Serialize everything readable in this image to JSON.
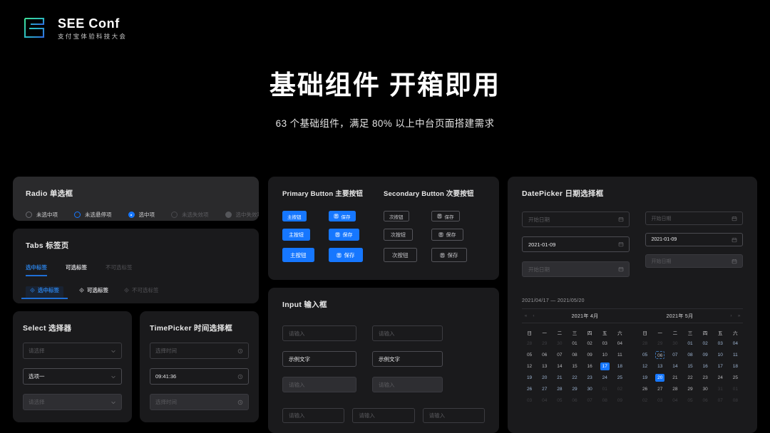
{
  "brand": {
    "title": "SEE Conf",
    "subtitle": "支付宝体验科技大会"
  },
  "hero": {
    "title": "基础组件 开箱即用",
    "subtitle": "63 个基础组件，满足 80% 以上中台页面搭建需求"
  },
  "accent": "#1677ff",
  "radio": {
    "title": "Radio 单选框",
    "options": [
      {
        "label": "未选中项",
        "state": "default"
      },
      {
        "label": "未选悬停项",
        "state": "hover"
      },
      {
        "label": "选中项",
        "state": "checked"
      },
      {
        "label": "未选失效项",
        "state": "disabled"
      },
      {
        "label": "选中失效项",
        "state": "checked-disabled"
      }
    ]
  },
  "tabs": {
    "title": "Tabs 标签页",
    "row1": [
      {
        "label": "选中标签",
        "state": "active"
      },
      {
        "label": "可选标签",
        "state": "default"
      },
      {
        "label": "不可选标签",
        "state": "disabled"
      }
    ],
    "row2": [
      {
        "label": "选中标签",
        "state": "active"
      },
      {
        "label": "可选标签",
        "state": "default"
      },
      {
        "label": "不可选标签",
        "state": "disabled"
      }
    ]
  },
  "select": {
    "title": "Select 选择器",
    "fields": [
      {
        "text": "请选择",
        "type": "placeholder"
      },
      {
        "text": "选项一",
        "type": "value"
      },
      {
        "text": "请选择",
        "type": "disabled"
      }
    ]
  },
  "timepicker": {
    "title": "TimePicker 时间选择框",
    "fields": [
      {
        "text": "选择时间",
        "type": "placeholder"
      },
      {
        "text": "09:41:36",
        "type": "value"
      },
      {
        "text": "选择时间",
        "type": "disabled"
      }
    ]
  },
  "buttons": {
    "primary_title": "Primary Button 主要按钮",
    "secondary_title": "Secondary Button 次要按钮",
    "primary_label": "主按钮",
    "primary_icon_label": "保存",
    "secondary_label": "次按钮",
    "secondary_icon_label": "保存",
    "sizes": [
      "s1",
      "s2",
      "s3"
    ]
  },
  "input": {
    "title": "Input 输入框",
    "left": [
      {
        "text": "请输入",
        "type": "placeholder"
      },
      {
        "text": "示例文字",
        "type": "value"
      },
      {
        "text": "请输入",
        "type": "disabled"
      }
    ],
    "right": [
      {
        "text": "请输入",
        "type": "placeholder"
      },
      {
        "text": "示例文字",
        "type": "value"
      },
      {
        "text": "请输入",
        "type": "disabled"
      }
    ],
    "bottom": [
      {
        "text": "请输入",
        "type": "placeholder"
      },
      {
        "text": "请输入",
        "type": "placeholder"
      },
      {
        "text": "请输入",
        "type": "placeholder"
      }
    ]
  },
  "datepicker": {
    "title": "DatePicker 日期选择框",
    "left": [
      {
        "text": "开始日期",
        "type": "placeholder"
      },
      {
        "text": "2021-01-09",
        "type": "value"
      },
      {
        "text": "开始日期",
        "type": "disabled"
      }
    ],
    "right": [
      {
        "text": "开始日期",
        "type": "placeholder"
      },
      {
        "text": "2021-01-09",
        "type": "value"
      },
      {
        "text": "开始日期",
        "type": "disabled"
      }
    ],
    "range_text": "2021/04/17 — 2021/05/20",
    "weekdays": [
      "日",
      "一",
      "二",
      "三",
      "四",
      "五",
      "六"
    ],
    "month_left": "2021年 4月",
    "month_right": "2021年 5月",
    "nav": {
      "prev_year": "«",
      "prev_month": "‹",
      "next_month": "›",
      "next_year": "»"
    },
    "calendar_left": {
      "weeks": [
        [
          {
            "d": "28",
            "c": "out"
          },
          {
            "d": "29",
            "c": "out"
          },
          {
            "d": "30",
            "c": "out"
          },
          {
            "d": "01",
            "c": ""
          },
          {
            "d": "02",
            "c": ""
          },
          {
            "d": "03",
            "c": ""
          },
          {
            "d": "04",
            "c": ""
          }
        ],
        [
          {
            "d": "05",
            "c": ""
          },
          {
            "d": "06",
            "c": ""
          },
          {
            "d": "07",
            "c": ""
          },
          {
            "d": "08",
            "c": ""
          },
          {
            "d": "09",
            "c": ""
          },
          {
            "d": "10",
            "c": ""
          },
          {
            "d": "11",
            "c": ""
          }
        ],
        [
          {
            "d": "12",
            "c": ""
          },
          {
            "d": "13",
            "c": ""
          },
          {
            "d": "14",
            "c": ""
          },
          {
            "d": "15",
            "c": ""
          },
          {
            "d": "16",
            "c": ""
          },
          {
            "d": "17",
            "c": "sel"
          },
          {
            "d": "18",
            "c": "rng"
          }
        ],
        [
          {
            "d": "19",
            "c": "rng"
          },
          {
            "d": "20",
            "c": "rng"
          },
          {
            "d": "21",
            "c": "rng"
          },
          {
            "d": "22",
            "c": "rng"
          },
          {
            "d": "23",
            "c": "rng"
          },
          {
            "d": "24",
            "c": "rng"
          },
          {
            "d": "25",
            "c": "rng"
          }
        ],
        [
          {
            "d": "26",
            "c": "rng"
          },
          {
            "d": "27",
            "c": "rng"
          },
          {
            "d": "28",
            "c": "rng"
          },
          {
            "d": "29",
            "c": "rng"
          },
          {
            "d": "30",
            "c": "rng"
          },
          {
            "d": "01",
            "c": "out"
          },
          {
            "d": "02",
            "c": "out"
          }
        ],
        [
          {
            "d": "03",
            "c": "out"
          },
          {
            "d": "04",
            "c": "out"
          },
          {
            "d": "05",
            "c": "out"
          },
          {
            "d": "06",
            "c": "out"
          },
          {
            "d": "07",
            "c": "out"
          },
          {
            "d": "08",
            "c": "out"
          },
          {
            "d": "09",
            "c": "out"
          }
        ]
      ]
    },
    "calendar_right": {
      "weeks": [
        [
          {
            "d": "28",
            "c": "out"
          },
          {
            "d": "29",
            "c": "out"
          },
          {
            "d": "30",
            "c": "out"
          },
          {
            "d": "01",
            "c": "rng"
          },
          {
            "d": "02",
            "c": "rng"
          },
          {
            "d": "03",
            "c": "rng"
          },
          {
            "d": "04",
            "c": "rng"
          }
        ],
        [
          {
            "d": "05",
            "c": "rng"
          },
          {
            "d": "06",
            "c": "today"
          },
          {
            "d": "07",
            "c": "rng"
          },
          {
            "d": "08",
            "c": "rng"
          },
          {
            "d": "09",
            "c": "rng"
          },
          {
            "d": "10",
            "c": "rng"
          },
          {
            "d": "11",
            "c": "rng"
          }
        ],
        [
          {
            "d": "12",
            "c": "rng"
          },
          {
            "d": "13",
            "c": "rng"
          },
          {
            "d": "14",
            "c": "rng"
          },
          {
            "d": "15",
            "c": "rng"
          },
          {
            "d": "16",
            "c": "rng"
          },
          {
            "d": "17",
            "c": "rng"
          },
          {
            "d": "18",
            "c": "rng"
          }
        ],
        [
          {
            "d": "19",
            "c": "rng"
          },
          {
            "d": "20",
            "c": "sel"
          },
          {
            "d": "21",
            "c": ""
          },
          {
            "d": "22",
            "c": ""
          },
          {
            "d": "23",
            "c": ""
          },
          {
            "d": "24",
            "c": ""
          },
          {
            "d": "25",
            "c": ""
          }
        ],
        [
          {
            "d": "26",
            "c": ""
          },
          {
            "d": "27",
            "c": ""
          },
          {
            "d": "28",
            "c": ""
          },
          {
            "d": "29",
            "c": ""
          },
          {
            "d": "30",
            "c": ""
          },
          {
            "d": "31",
            "c": "dis"
          },
          {
            "d": "01",
            "c": "out"
          }
        ],
        [
          {
            "d": "02",
            "c": "out"
          },
          {
            "d": "03",
            "c": "out"
          },
          {
            "d": "04",
            "c": "out"
          },
          {
            "d": "05",
            "c": "out"
          },
          {
            "d": "06",
            "c": "out"
          },
          {
            "d": "07",
            "c": "out"
          },
          {
            "d": "08",
            "c": "out"
          }
        ]
      ]
    }
  }
}
